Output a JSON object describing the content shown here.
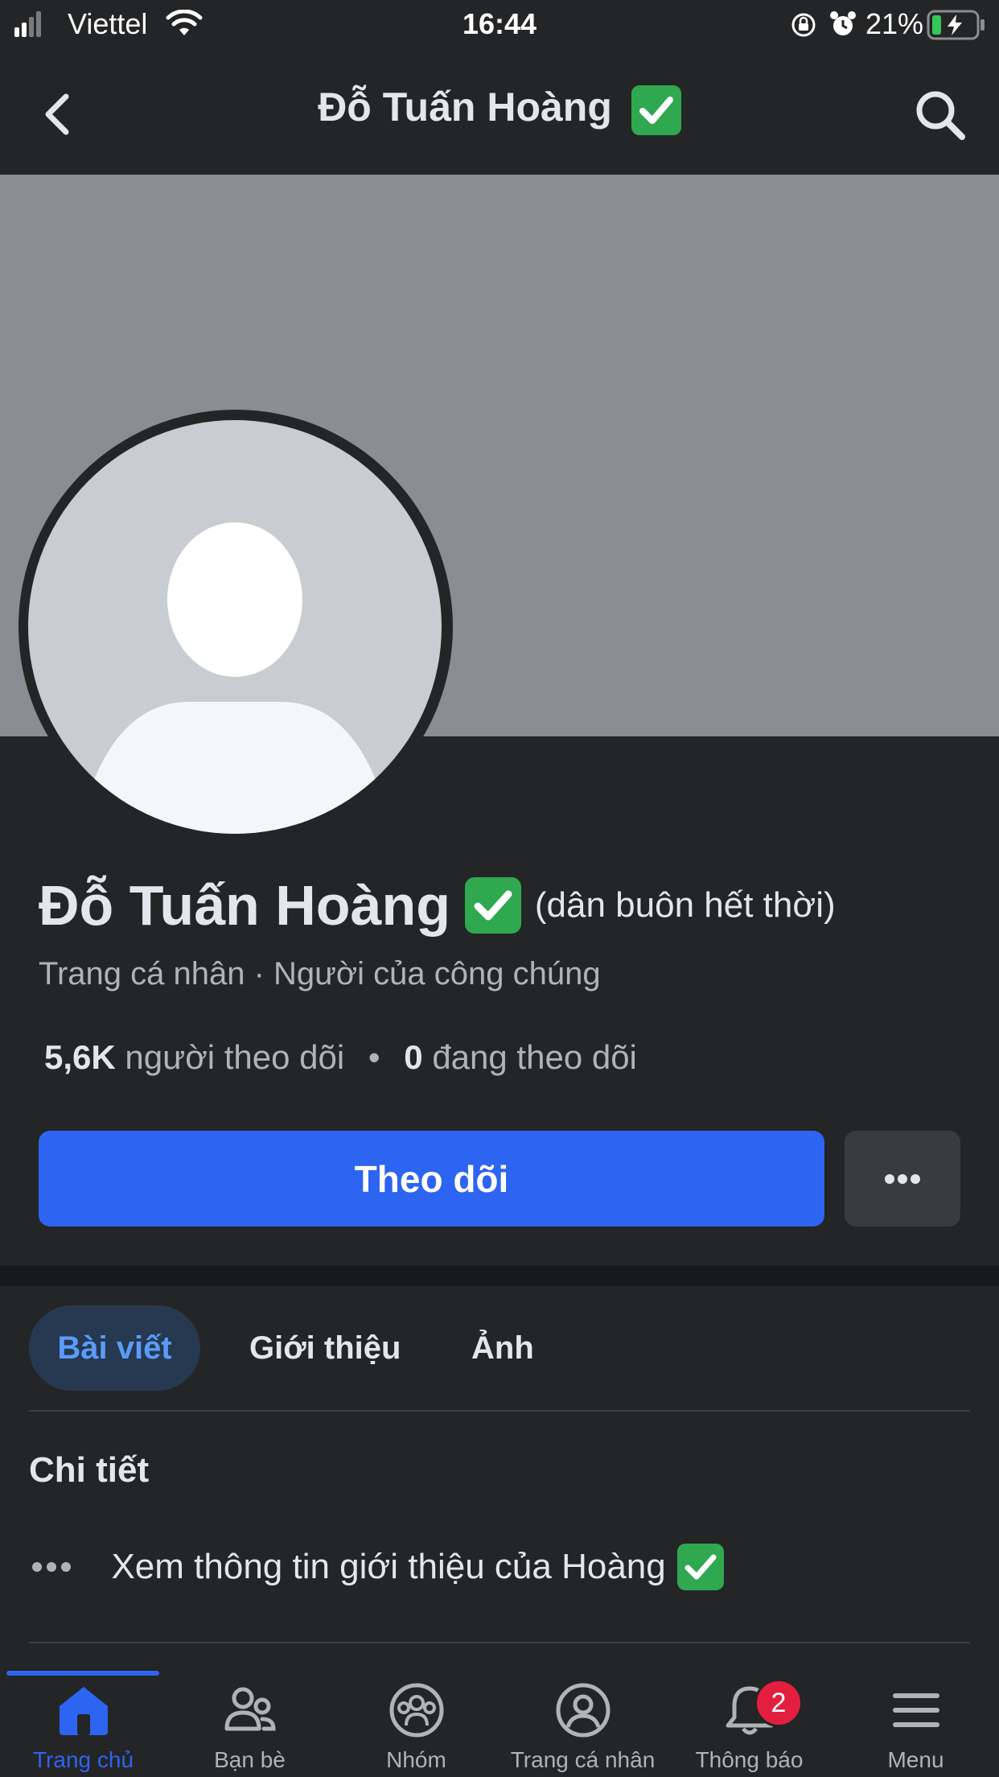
{
  "status_bar": {
    "carrier": "Viettel",
    "time": "16:44",
    "battery_percent": "21%",
    "battery_level": 0.21,
    "signal_bars": 2
  },
  "header": {
    "title": "Đỗ Tuấn Hoàng"
  },
  "profile": {
    "name": "Đỗ Tuấn Hoàng",
    "nickname": "(dân buôn hết thời)",
    "meta": "Trang cá nhân · Người của công chúng",
    "followers_count": "5,6K",
    "followers_label": "người theo dõi",
    "separator": "•",
    "following_count": "0",
    "following_label": "đang theo dõi",
    "follow_button": "Theo dõi"
  },
  "tabs": [
    {
      "label": "Bài viết",
      "active": true
    },
    {
      "label": "Giới thiệu",
      "active": false
    },
    {
      "label": "Ảnh",
      "active": false
    }
  ],
  "details": {
    "title": "Chi tiết",
    "see_about": "Xem thông tin giới thiệu của Hoàng"
  },
  "bottom_nav": [
    {
      "label": "Trang chủ",
      "icon": "home-icon",
      "active": true
    },
    {
      "label": "Bạn bè",
      "icon": "friends-icon",
      "active": false
    },
    {
      "label": "Nhóm",
      "icon": "groups-icon",
      "active": false
    },
    {
      "label": "Trang cá nhân",
      "icon": "profile-icon",
      "active": false
    },
    {
      "label": "Thông báo",
      "icon": "bell-icon",
      "active": false,
      "badge": "2"
    },
    {
      "label": "Menu",
      "icon": "menu-icon",
      "active": false
    }
  ],
  "colors": {
    "background": "#242526",
    "accent": "#2d64f2",
    "verified": "#2fa84f",
    "badge": "#e41e3f"
  }
}
